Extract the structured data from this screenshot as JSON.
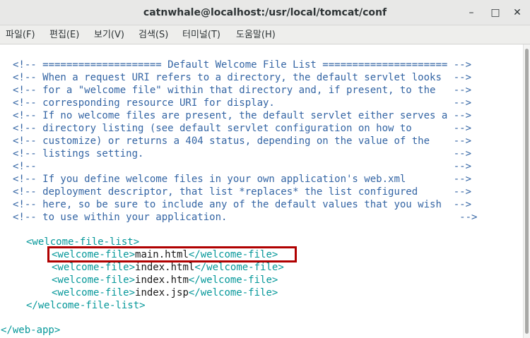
{
  "window": {
    "title": "catnwhale@localhost:/usr/local/tomcat/conf",
    "minimize_glyph": "–",
    "maximize_glyph": "□",
    "close_glyph": "✕"
  },
  "menu": [
    {
      "label": "파일(F)"
    },
    {
      "label": "편집(E)"
    },
    {
      "label": "보기(V)"
    },
    {
      "label": "검색(S)"
    },
    {
      "label": "터미널(T)"
    },
    {
      "label": "도움말(H)"
    }
  ],
  "terminal": {
    "comments": [
      "<!-- ==================== Default Welcome File List ===================== -->",
      "<!-- When a request URI refers to a directory, the default servlet looks  -->",
      "<!-- for a \"welcome file\" within that directory and, if present, to the   -->",
      "<!-- corresponding resource URI for display.                              -->",
      "<!-- If no welcome files are present, the default servlet either serves a -->",
      "<!-- directory listing (see default servlet configuration on how to       -->",
      "<!-- customize) or returns a 404 status, depending on the value of the    -->",
      "<!-- listings setting.                                                    -->",
      "<!--                                                                      -->",
      "<!-- If you define welcome files in your own application's web.xml        -->",
      "<!-- deployment descriptor, that list *replaces* the list configured      -->",
      "<!-- here, so be sure to include any of the default values that you wish  -->",
      "<!-- to use within your application.                                       -->"
    ],
    "list_open": "<welcome-file-list>",
    "list_close": "</welcome-file-list>",
    "welcome_open": "<welcome-file>",
    "welcome_close": "</welcome-file>",
    "welcome_files": [
      "main.html",
      "index.html",
      "index.htm",
      "index.jsp"
    ],
    "webapp_close": "</web-app>"
  },
  "colors": {
    "comment": "#3465a4",
    "tag": "#06989a",
    "highlight_border": "#b00000"
  }
}
